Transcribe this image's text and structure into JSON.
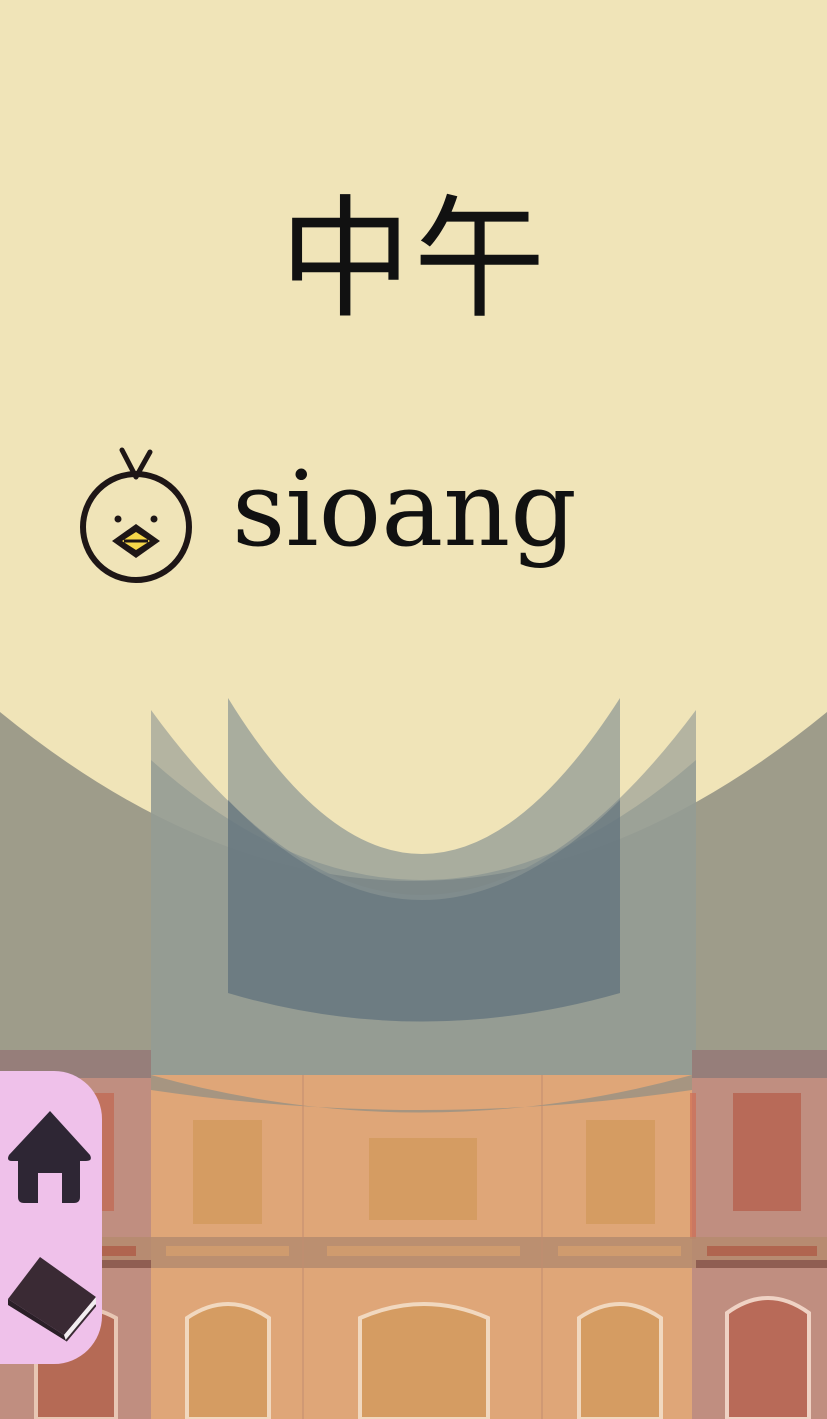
{
  "card": {
    "hanzi": "中午",
    "romanization": "sioang"
  },
  "icons": {
    "speaker": "chick-icon",
    "home": "home-icon",
    "book": "book-icon"
  },
  "colors": {
    "background": "#f0e4b8",
    "menu": "#efc1ea",
    "icon_dark": "#2e2634",
    "chick_beak": "#f5d64a"
  }
}
